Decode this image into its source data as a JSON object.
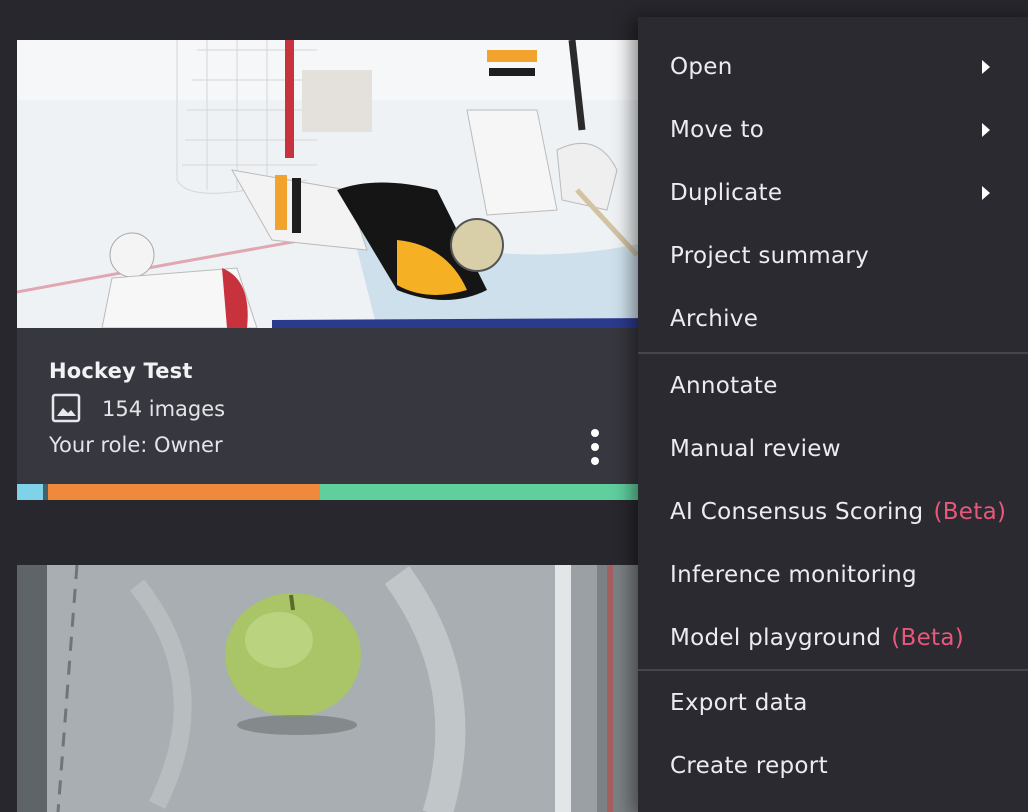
{
  "projects": [
    {
      "title": "Hockey Test",
      "image_count": "154 images",
      "role_label": "Your role:",
      "role_value": "Owner",
      "progress": [
        {
          "fraction": 0.04,
          "color": "#7fd3e8"
        },
        {
          "fraction": 0.008,
          "color": "#44616a"
        },
        {
          "fraction": 0.425,
          "color": "#ef8a3c"
        },
        {
          "fraction": 0.527,
          "color": "#5fcf9d"
        }
      ]
    }
  ],
  "menu": {
    "groups": [
      {
        "items": [
          {
            "label": "Open",
            "submenu": true
          },
          {
            "label": "Move to",
            "submenu": true
          },
          {
            "label": "Duplicate",
            "submenu": true
          },
          {
            "label": "Project summary",
            "submenu": false
          },
          {
            "label": "Archive",
            "submenu": false
          }
        ]
      },
      {
        "items": [
          {
            "label": "Annotate"
          },
          {
            "label": "Manual review"
          },
          {
            "label": "AI Consensus Scoring",
            "badge": "(Beta)"
          },
          {
            "label": "Inference monitoring"
          },
          {
            "label": "Model playground",
            "badge": "(Beta)"
          }
        ]
      },
      {
        "items": [
          {
            "label": "Export data"
          },
          {
            "label": "Create report"
          }
        ]
      }
    ]
  },
  "colors": {
    "background": "#27272d",
    "card": "#37373f",
    "menu": "#2a2a30",
    "beta": "#e9587a"
  },
  "icons": {
    "image": "image-icon",
    "more": "more-vertical-icon",
    "submenu": "chevron-right-icon"
  }
}
